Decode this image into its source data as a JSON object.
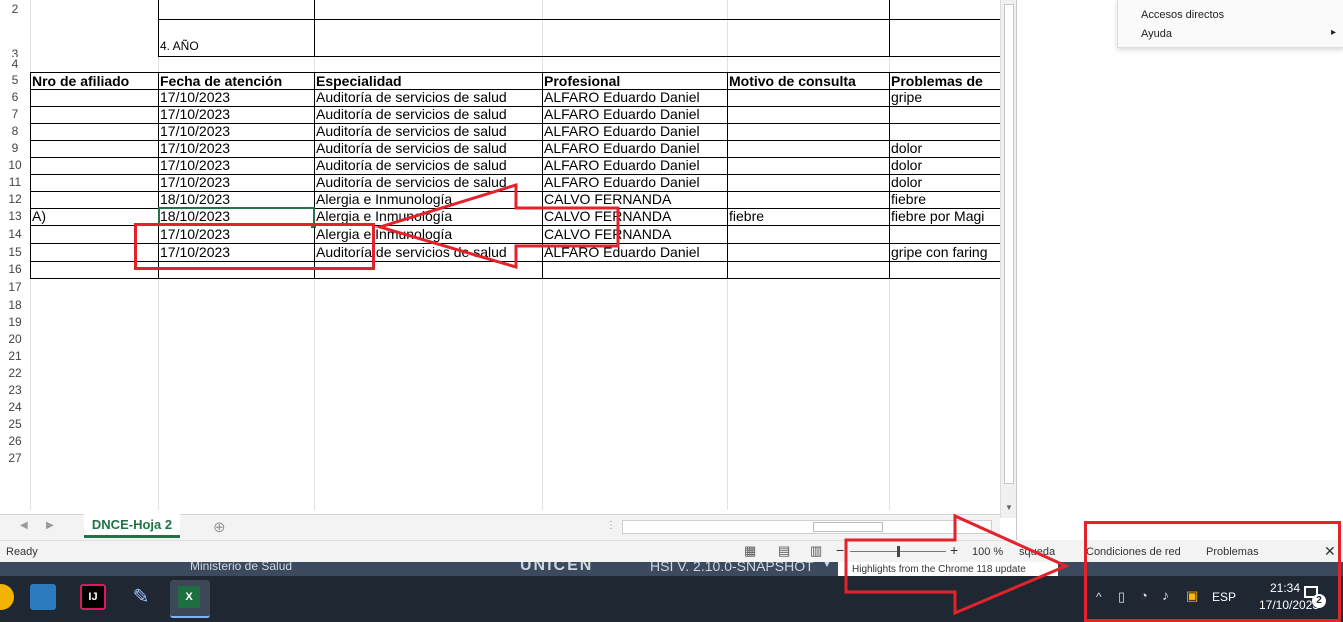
{
  "spreadsheet": {
    "row_numbers": [
      "2",
      "3",
      "4",
      "5",
      "6",
      "7",
      "8",
      "9",
      "10",
      "11",
      "12",
      "13",
      "14",
      "15",
      "16",
      "17",
      "18",
      "19",
      "20",
      "21",
      "22",
      "23",
      "24",
      "25",
      "26",
      "27"
    ],
    "year_label": "4. AÑO",
    "columns": [
      "Nro de afiliado",
      "Fecha de atención",
      "Especialidad",
      "Profesional",
      "Motivo de consulta",
      "Problemas de"
    ],
    "rows": [
      {
        "afiliado": "",
        "fecha": "17/10/2023",
        "especialidad": "Auditoría de servicios de salud",
        "profesional": "ALFARO  Eduardo Daniel",
        "motivo": "",
        "problemas": "gripe"
      },
      {
        "afiliado": "",
        "fecha": "17/10/2023",
        "especialidad": "Auditoría de servicios de salud",
        "profesional": "ALFARO  Eduardo Daniel",
        "motivo": "",
        "problemas": ""
      },
      {
        "afiliado": "",
        "fecha": "17/10/2023",
        "especialidad": "Auditoría de servicios de salud",
        "profesional": "ALFARO  Eduardo Daniel",
        "motivo": "",
        "problemas": ""
      },
      {
        "afiliado": "",
        "fecha": "17/10/2023",
        "especialidad": "Auditoría de servicios de salud",
        "profesional": "ALFARO  Eduardo Daniel",
        "motivo": "",
        "problemas": "dolor"
      },
      {
        "afiliado": "",
        "fecha": "17/10/2023",
        "especialidad": "Auditoría de servicios de salud",
        "profesional": "ALFARO  Eduardo Daniel",
        "motivo": "",
        "problemas": "dolor"
      },
      {
        "afiliado": "",
        "fecha": "17/10/2023",
        "especialidad": "Auditoría de servicios de salud",
        "profesional": "ALFARO  Eduardo Daniel",
        "motivo": "",
        "problemas": "dolor"
      },
      {
        "afiliado": "",
        "fecha": "18/10/2023",
        "especialidad": "Alergia e Inmunología",
        "profesional": "CALVO  FERNANDA",
        "motivo": "",
        "problemas": "fiebre"
      },
      {
        "afiliado": "A)",
        "fecha": "18/10/2023",
        "especialidad": "Alergia e Inmunología",
        "profesional": "CALVO  FERNANDA",
        "motivo": "fiebre",
        "problemas": "fiebre por Magi"
      },
      {
        "afiliado": "",
        "fecha": "17/10/2023",
        "especialidad": "Alergia e Inmunología",
        "profesional": "CALVO  FERNANDA",
        "motivo": "",
        "problemas": ""
      },
      {
        "afiliado": "",
        "fecha": "17/10/2023",
        "especialidad": "Auditoría de servicios de salud",
        "profesional": "ALFARO  Eduardo Daniel",
        "motivo": "",
        "problemas": "gripe con faring"
      }
    ],
    "sheet_tab": "DNCE-Hoja 2",
    "add_sheet_symbol": "⊕",
    "status": "Ready",
    "zoom": "100 %",
    "zoom_minus": "−",
    "zoom_plus": "+"
  },
  "context_menu": {
    "items": [
      "Accesos directos",
      "Ayuda"
    ],
    "submenu_arrow": "▸"
  },
  "ide_panel": {
    "tabs": [
      "squeda",
      "Condiciones de red",
      "Problemas"
    ],
    "close_symbol": "✕",
    "highlight_text": "Highlights from the Chrome 118 update"
  },
  "background_app": {
    "ministerio": "Ministerio de Salud",
    "unicen": "UNICEN",
    "version": "HSI V. 2.10.0-SNAPSHOT"
  },
  "taskbar": {
    "language": "ESP",
    "time": "21:34",
    "date": "17/10/2023",
    "notification_count": "2",
    "chevron": "^"
  },
  "colors": {
    "annotation_red": "#e3222b",
    "taskbar_bg": "#1f2733",
    "tab_green": "#217346"
  }
}
